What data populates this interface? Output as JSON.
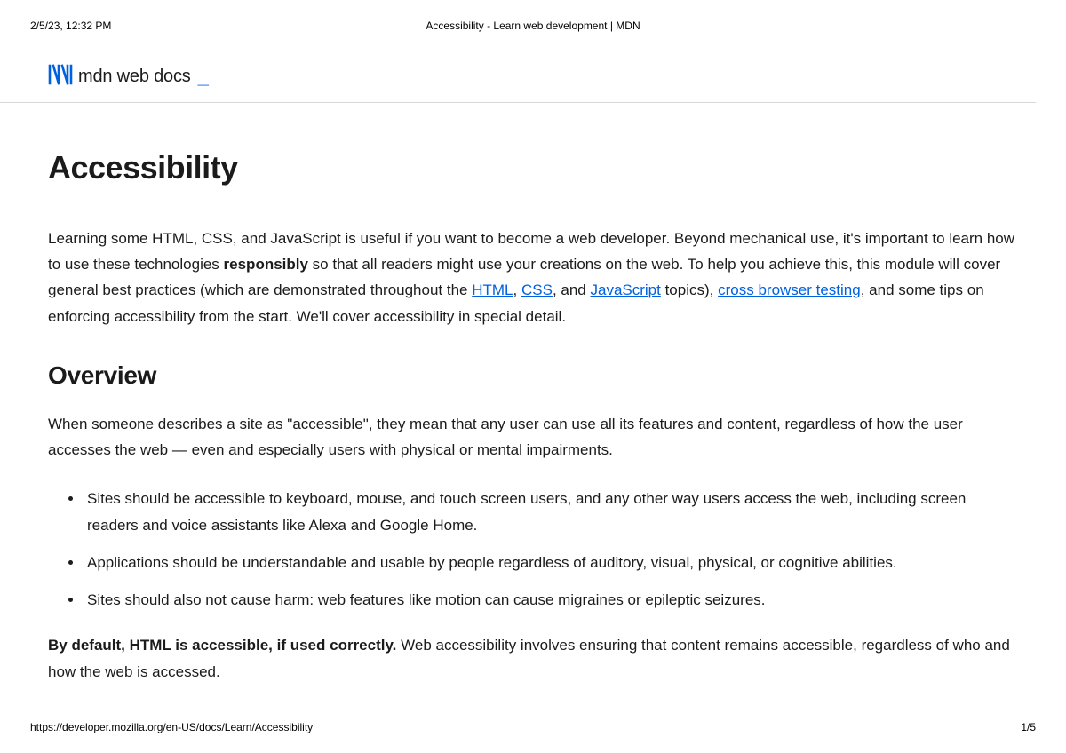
{
  "print": {
    "timestamp": "2/5/23, 12:32 PM",
    "doc_title": "Accessibility - Learn web development | MDN",
    "footer_url": "https://developer.mozilla.org/en-US/docs/Learn/Accessibility",
    "page_number": "1/5"
  },
  "logo": {
    "text": "mdn web docs",
    "underscore": "_"
  },
  "page": {
    "h1": "Accessibility",
    "intro": {
      "pre": "Learning some HTML, CSS, and JavaScript is useful if you want to become a web developer. Beyond mechanical use, it's important to learn how to use these technologies ",
      "bold": "responsibly",
      "mid1": " so that all readers might use your creations on the web. To help you achieve this, this module will cover general best practices (which are demonstrated throughout the ",
      "link_html": "HTML",
      "sep1": ", ",
      "link_css": "CSS",
      "sep2": ", and ",
      "link_js": "JavaScript",
      "mid2": " topics), ",
      "link_cbt": "cross browser testing",
      "tail": ", and some tips on enforcing accessibility from the start. We'll cover accessibility in special detail."
    },
    "h2_overview": "Overview",
    "overview_p": "When someone describes a site as \"accessible\", they mean that any user can use all its features and content, regardless of how the user accesses the web — even and especially users with physical or mental impairments.",
    "bullets": [
      "Sites should be accessible to keyboard, mouse, and touch screen users, and any other way users access the web, including screen readers and voice assistants like Alexa and Google Home.",
      "Applications should be understandable and usable by people regardless of auditory, visual, physical, or cognitive abilities.",
      "Sites should also not cause harm: web features like motion can cause migraines or epileptic seizures."
    ],
    "closing": {
      "bold": "By default, HTML is accessible, if used correctly.",
      "rest": " Web accessibility involves ensuring that content remains accessible, regardless of who and how the web is accessed."
    }
  }
}
